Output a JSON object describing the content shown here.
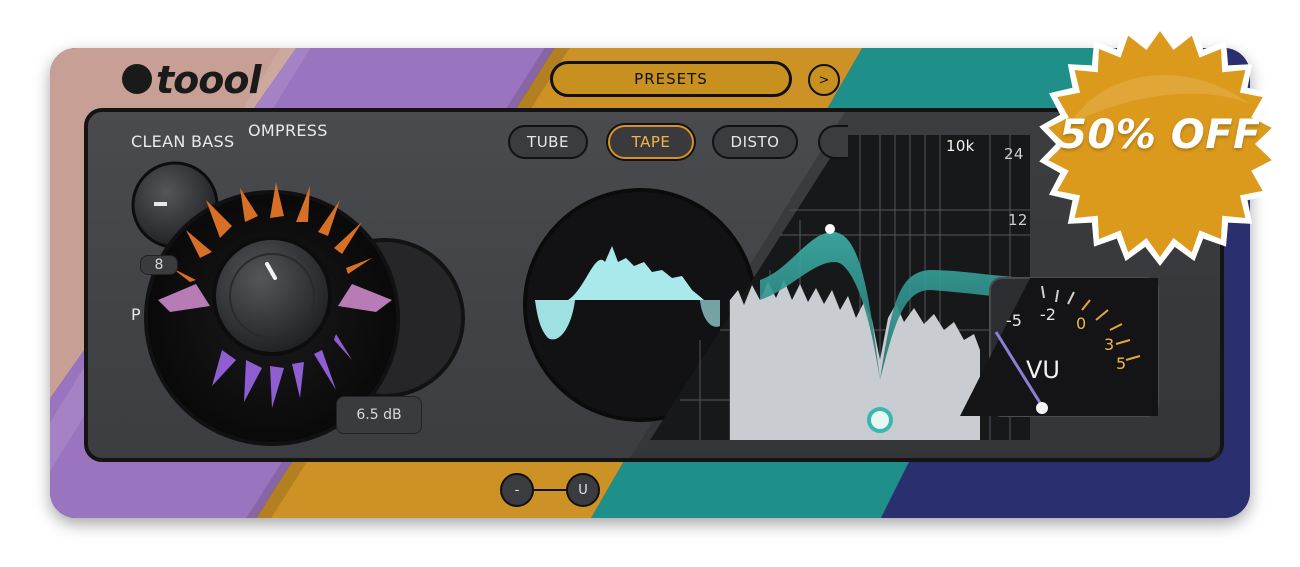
{
  "brand": {
    "logo_text": "toool"
  },
  "presets": {
    "label": "PRESETS",
    "next_label": ">"
  },
  "modules": {
    "clean_bass": {
      "label": "CLEAN BASS",
      "value": "8"
    },
    "compress": {
      "label": "OMPRESS",
      "value": "6.5 dB",
      "partial_label": "P"
    },
    "saturation": {
      "modes": [
        "TUBE",
        "TAPE",
        "DISTO"
      ],
      "active": "TAPE"
    },
    "eq": {
      "freq_label": "10k",
      "gain_labels": [
        "24",
        "12"
      ]
    },
    "vu": {
      "label": "VU",
      "scale_white": [
        "-5",
        "-2"
      ],
      "scale_orange": [
        "0",
        "3",
        "5"
      ]
    }
  },
  "bottom_controls": {
    "left": "-",
    "right": "U"
  },
  "promo": {
    "badge_text": "50% OFF"
  },
  "colors": {
    "pink": "#c79f95",
    "purple": "#9a74bf",
    "gold": "#cc9226",
    "teal": "#1f8f8a",
    "navy": "#2a2f70",
    "badge": "#dc9a1d",
    "accent_orange": "#f1b44a"
  }
}
